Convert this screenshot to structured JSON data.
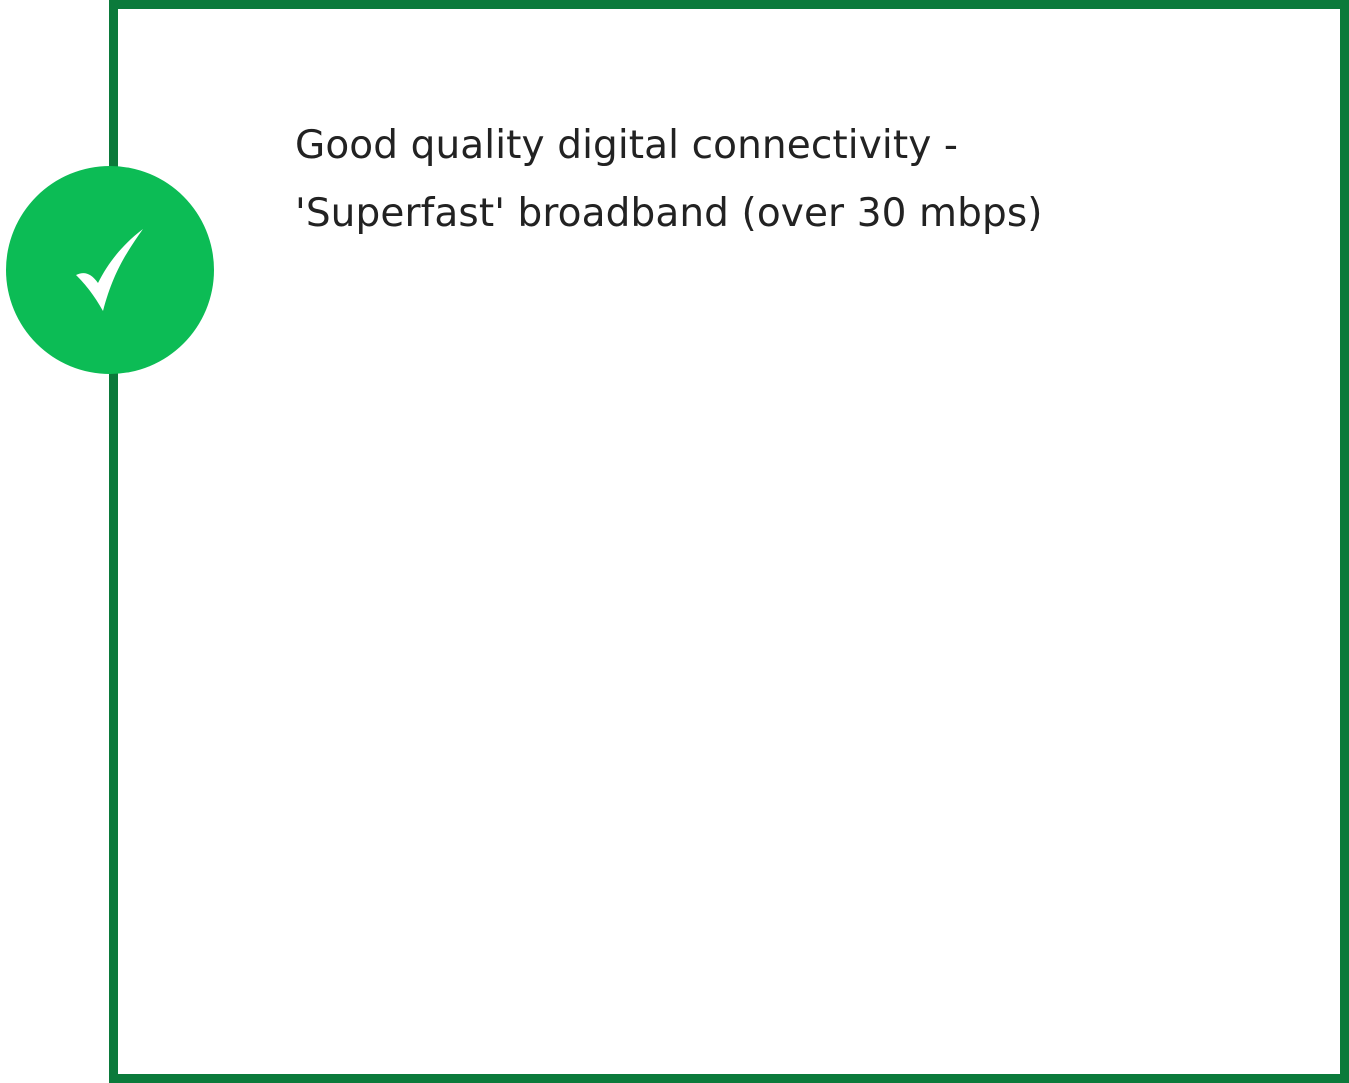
{
  "card": {
    "line1": "Good quality digital connectivity  -",
    "line2": "'Superfast' broadband (over 30 mbps)"
  },
  "status": {
    "icon": "checkmark-icon"
  },
  "colors": {
    "frame": "#0b7a3b",
    "badge": "#0cbc55",
    "text": "#222222",
    "background": "#ffffff"
  }
}
